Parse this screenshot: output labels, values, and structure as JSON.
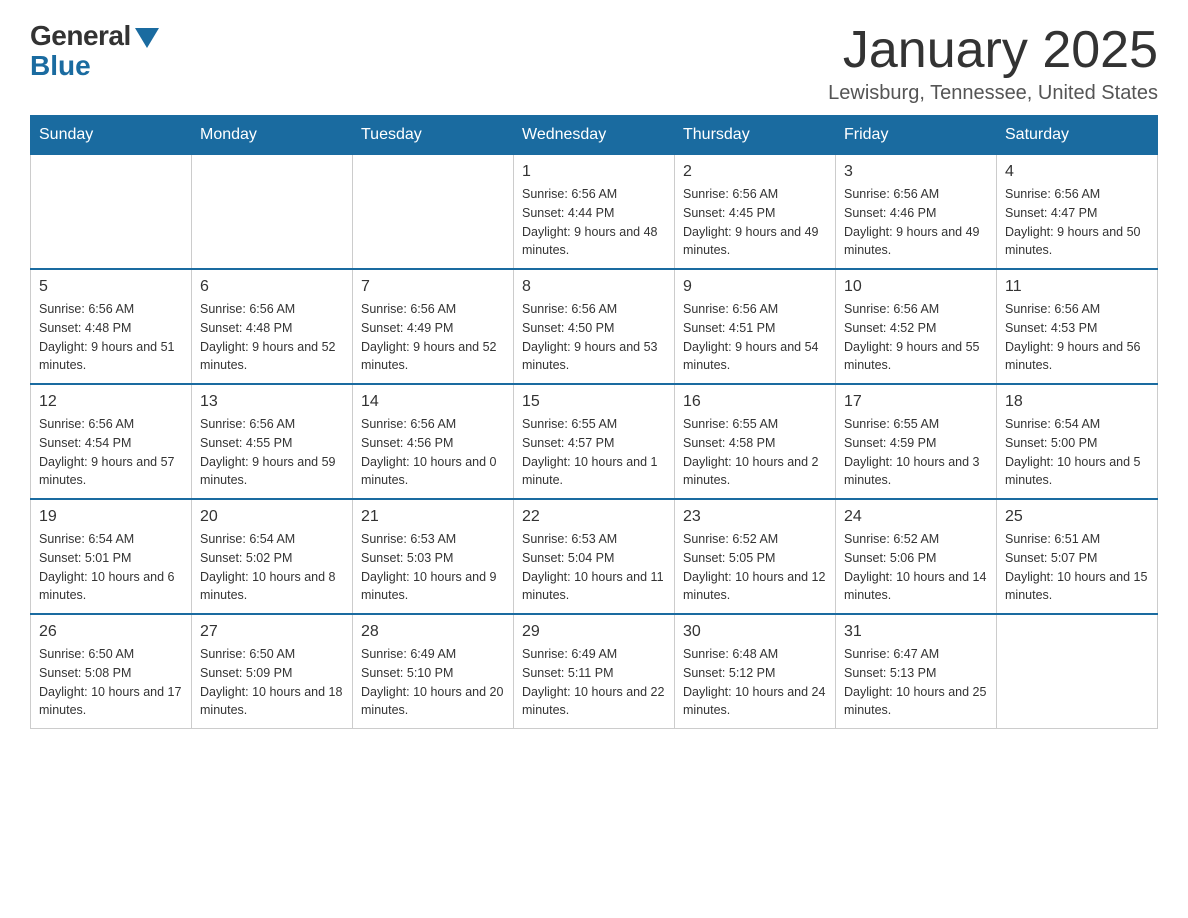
{
  "header": {
    "logo_general": "General",
    "logo_blue": "Blue",
    "month_title": "January 2025",
    "location": "Lewisburg, Tennessee, United States"
  },
  "days_of_week": [
    "Sunday",
    "Monday",
    "Tuesday",
    "Wednesday",
    "Thursday",
    "Friday",
    "Saturday"
  ],
  "weeks": [
    [
      null,
      null,
      null,
      {
        "day": "1",
        "sunrise": "6:56 AM",
        "sunset": "4:44 PM",
        "daylight": "9 hours and 48 minutes."
      },
      {
        "day": "2",
        "sunrise": "6:56 AM",
        "sunset": "4:45 PM",
        "daylight": "9 hours and 49 minutes."
      },
      {
        "day": "3",
        "sunrise": "6:56 AM",
        "sunset": "4:46 PM",
        "daylight": "9 hours and 49 minutes."
      },
      {
        "day": "4",
        "sunrise": "6:56 AM",
        "sunset": "4:47 PM",
        "daylight": "9 hours and 50 minutes."
      }
    ],
    [
      {
        "day": "5",
        "sunrise": "6:56 AM",
        "sunset": "4:48 PM",
        "daylight": "9 hours and 51 minutes."
      },
      {
        "day": "6",
        "sunrise": "6:56 AM",
        "sunset": "4:48 PM",
        "daylight": "9 hours and 52 minutes."
      },
      {
        "day": "7",
        "sunrise": "6:56 AM",
        "sunset": "4:49 PM",
        "daylight": "9 hours and 52 minutes."
      },
      {
        "day": "8",
        "sunrise": "6:56 AM",
        "sunset": "4:50 PM",
        "daylight": "9 hours and 53 minutes."
      },
      {
        "day": "9",
        "sunrise": "6:56 AM",
        "sunset": "4:51 PM",
        "daylight": "9 hours and 54 minutes."
      },
      {
        "day": "10",
        "sunrise": "6:56 AM",
        "sunset": "4:52 PM",
        "daylight": "9 hours and 55 minutes."
      },
      {
        "day": "11",
        "sunrise": "6:56 AM",
        "sunset": "4:53 PM",
        "daylight": "9 hours and 56 minutes."
      }
    ],
    [
      {
        "day": "12",
        "sunrise": "6:56 AM",
        "sunset": "4:54 PM",
        "daylight": "9 hours and 57 minutes."
      },
      {
        "day": "13",
        "sunrise": "6:56 AM",
        "sunset": "4:55 PM",
        "daylight": "9 hours and 59 minutes."
      },
      {
        "day": "14",
        "sunrise": "6:56 AM",
        "sunset": "4:56 PM",
        "daylight": "10 hours and 0 minutes."
      },
      {
        "day": "15",
        "sunrise": "6:55 AM",
        "sunset": "4:57 PM",
        "daylight": "10 hours and 1 minute."
      },
      {
        "day": "16",
        "sunrise": "6:55 AM",
        "sunset": "4:58 PM",
        "daylight": "10 hours and 2 minutes."
      },
      {
        "day": "17",
        "sunrise": "6:55 AM",
        "sunset": "4:59 PM",
        "daylight": "10 hours and 3 minutes."
      },
      {
        "day": "18",
        "sunrise": "6:54 AM",
        "sunset": "5:00 PM",
        "daylight": "10 hours and 5 minutes."
      }
    ],
    [
      {
        "day": "19",
        "sunrise": "6:54 AM",
        "sunset": "5:01 PM",
        "daylight": "10 hours and 6 minutes."
      },
      {
        "day": "20",
        "sunrise": "6:54 AM",
        "sunset": "5:02 PM",
        "daylight": "10 hours and 8 minutes."
      },
      {
        "day": "21",
        "sunrise": "6:53 AM",
        "sunset": "5:03 PM",
        "daylight": "10 hours and 9 minutes."
      },
      {
        "day": "22",
        "sunrise": "6:53 AM",
        "sunset": "5:04 PM",
        "daylight": "10 hours and 11 minutes."
      },
      {
        "day": "23",
        "sunrise": "6:52 AM",
        "sunset": "5:05 PM",
        "daylight": "10 hours and 12 minutes."
      },
      {
        "day": "24",
        "sunrise": "6:52 AM",
        "sunset": "5:06 PM",
        "daylight": "10 hours and 14 minutes."
      },
      {
        "day": "25",
        "sunrise": "6:51 AM",
        "sunset": "5:07 PM",
        "daylight": "10 hours and 15 minutes."
      }
    ],
    [
      {
        "day": "26",
        "sunrise": "6:50 AM",
        "sunset": "5:08 PM",
        "daylight": "10 hours and 17 minutes."
      },
      {
        "day": "27",
        "sunrise": "6:50 AM",
        "sunset": "5:09 PM",
        "daylight": "10 hours and 18 minutes."
      },
      {
        "day": "28",
        "sunrise": "6:49 AM",
        "sunset": "5:10 PM",
        "daylight": "10 hours and 20 minutes."
      },
      {
        "day": "29",
        "sunrise": "6:49 AM",
        "sunset": "5:11 PM",
        "daylight": "10 hours and 22 minutes."
      },
      {
        "day": "30",
        "sunrise": "6:48 AM",
        "sunset": "5:12 PM",
        "daylight": "10 hours and 24 minutes."
      },
      {
        "day": "31",
        "sunrise": "6:47 AM",
        "sunset": "5:13 PM",
        "daylight": "10 hours and 25 minutes."
      },
      null
    ]
  ],
  "labels": {
    "sunrise_prefix": "Sunrise: ",
    "sunset_prefix": "Sunset: ",
    "daylight_prefix": "Daylight: "
  }
}
